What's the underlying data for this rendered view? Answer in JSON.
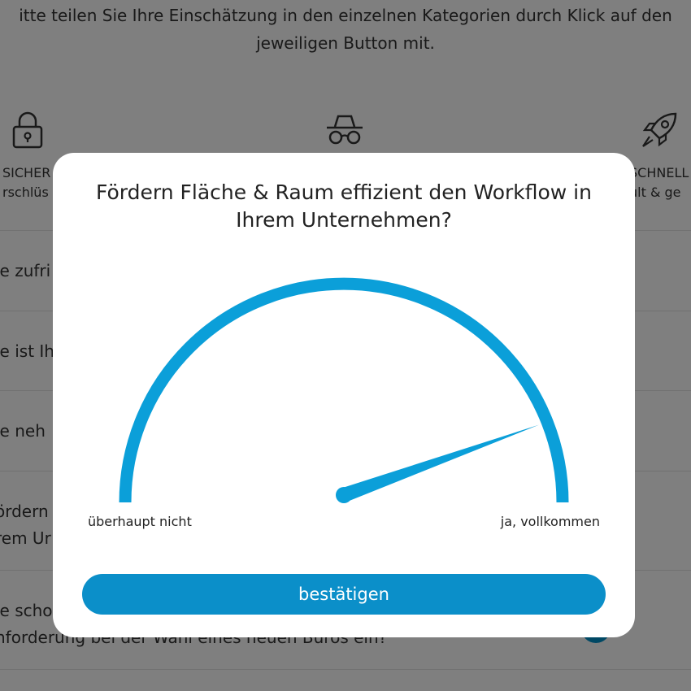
{
  "intro_text": {
    "line1": "itte teilen Sie Ihre Einschätzung in den einzelnen Kategorien durch Klick auf den",
    "line2": "jeweiligen Button mit."
  },
  "categories": [
    {
      "icon": "lock-icon",
      "label1": "SICHER",
      "label2": "rschlüs"
    },
    {
      "icon": "spy-icon",
      "label1": "",
      "label2": ""
    },
    {
      "icon": "rocket-icon",
      "label1": "SCHNELL",
      "label2": "ult & ge"
    }
  ],
  "rows": [
    {
      "text1": "ie zufri"
    },
    {
      "text1": "ie ist Ih"
    },
    {
      "text1": "ie neh"
    },
    {
      "text1": "ördern",
      "text2": "rem Ur"
    },
    {
      "text1": "ie scho",
      "text2": "nforderung bei der Wahl eines neuen Büros ein?"
    }
  ],
  "modal": {
    "question": "Fördern Fläche & Raum effizient den Workflow in Ihrem Unternehmen?",
    "scale_min_label": "überhaupt nicht",
    "scale_max_label": "ja, vollkommen",
    "gauge_value": 0.89,
    "confirm_label": "bestätigen"
  },
  "colors": {
    "accent": "#0b9fd9",
    "button": "#0b8fc9",
    "overlay": "rgba(0,0,0,0.5)"
  }
}
